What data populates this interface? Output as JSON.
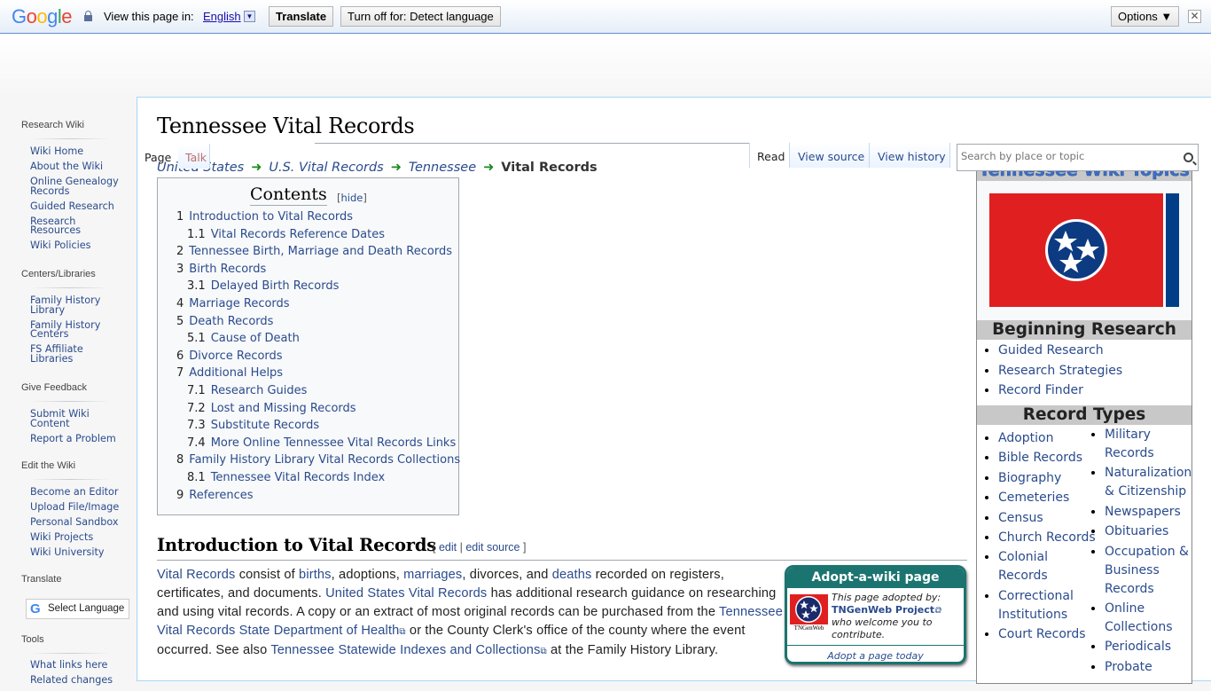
{
  "translate_bar": {
    "logo": [
      "G",
      "o",
      "o",
      "g",
      "l",
      "e"
    ],
    "view_label": "View this page in:",
    "language": "English",
    "language_dropdown": "▼",
    "translate_button": "Translate",
    "turn_off_button": "Turn off for: Detect language",
    "options_button": "Options ▼",
    "close": "✕"
  },
  "sidebar": {
    "sections": [
      {
        "heading": "Research Wiki",
        "items": [
          "Wiki Home",
          "About the Wiki",
          "Online Genealogy Records",
          "Guided Research",
          "Research Resources",
          "Wiki Policies"
        ]
      },
      {
        "heading": "Centers/Libraries",
        "items": [
          "Family History Library",
          "Family History Centers",
          "FS Affiliate Libraries"
        ]
      },
      {
        "heading": "Give Feedback",
        "items": [
          "Submit Wiki Content",
          "Report a Problem"
        ]
      },
      {
        "heading": "Edit the Wiki",
        "items": [
          "Become an Editor",
          "Upload File/Image",
          "Personal Sandbox",
          "Wiki Projects",
          "Wiki University"
        ]
      },
      {
        "heading": "Translate",
        "items": []
      },
      {
        "heading": "Tools",
        "items": [
          "What links here",
          "Related changes"
        ]
      }
    ],
    "select_language": "Select Language",
    "select_language_icon": "G"
  },
  "page": {
    "title": "Tennessee Vital Records",
    "tabs": {
      "page": "Page",
      "talk": "Talk",
      "read": "Read",
      "view_source": "View source",
      "view_history": "View history"
    },
    "search_placeholder": "Search by place or topic",
    "breadcrumb": [
      "United States",
      "U.S. Vital Records",
      "Tennessee",
      "Vital Records"
    ],
    "breadcrumb_arrow": "➜"
  },
  "toc": {
    "title": "Contents",
    "hide_label": "hide",
    "items": [
      {
        "num": "1",
        "label": "Introduction to Vital Records",
        "level": 1
      },
      {
        "num": "1.1",
        "label": "Vital Records Reference Dates",
        "level": 2
      },
      {
        "num": "2",
        "label": "Tennessee Birth, Marriage and Death Records",
        "level": 1
      },
      {
        "num": "3",
        "label": "Birth Records",
        "level": 1
      },
      {
        "num": "3.1",
        "label": "Delayed Birth Records",
        "level": 2
      },
      {
        "num": "4",
        "label": "Marriage Records",
        "level": 1
      },
      {
        "num": "5",
        "label": "Death Records",
        "level": 1
      },
      {
        "num": "5.1",
        "label": "Cause of Death",
        "level": 2
      },
      {
        "num": "6",
        "label": "Divorce Records",
        "level": 1
      },
      {
        "num": "7",
        "label": "Additional Helps",
        "level": 1
      },
      {
        "num": "7.1",
        "label": "Research Guides",
        "level": 2
      },
      {
        "num": "7.2",
        "label": "Lost and Missing Records",
        "level": 2
      },
      {
        "num": "7.3",
        "label": "Substitute Records",
        "level": 2
      },
      {
        "num": "7.4",
        "label": "More Online Tennessee Vital Records Links",
        "level": 2
      },
      {
        "num": "8",
        "label": "Family History Library Vital Records Collections",
        "level": 1
      },
      {
        "num": "8.1",
        "label": "Tennessee Vital Records Index",
        "level": 2
      },
      {
        "num": "9",
        "label": "References",
        "level": 1
      }
    ]
  },
  "section": {
    "heading": "Introduction to Vital Records",
    "edit": "edit",
    "edit_source": "edit source",
    "paragraph": [
      {
        "t": "Vital Records",
        "link": true
      },
      {
        "t": " consist of ",
        "link": false
      },
      {
        "t": "births",
        "link": true
      },
      {
        "t": ", adoptions, ",
        "link": false
      },
      {
        "t": "marriages",
        "link": true
      },
      {
        "t": ", divorces, and ",
        "link": false
      },
      {
        "t": "deaths",
        "link": true
      },
      {
        "t": " recorded on registers, certificates, and documents. ",
        "link": false
      },
      {
        "t": "United States Vital Records",
        "link": true
      },
      {
        "t": " has additional research guidance on researching and using vital records. A copy or an extract of most original records can be purchased from the ",
        "link": false
      },
      {
        "t": "Tennessee Vital Records State Department of Health",
        "link": true,
        "external": true
      },
      {
        "t": " or the County Clerk's office of the county where the event occurred. See also ",
        "link": false
      },
      {
        "t": "Tennessee Statewide Indexes and Collections",
        "link": true,
        "external": true
      },
      {
        "t": " at the Family History Library.",
        "link": false
      }
    ]
  },
  "adopt": {
    "header": "Adopt-a-wiki page",
    "line1": "This page adopted by:",
    "adopter": "TNGenWeb Project",
    "line2": "who welcome you to contribute.",
    "logo_caption": "TNGenWeb",
    "footer": "Adopt a page today"
  },
  "infobox": {
    "title": "Tennessee Wiki Topics",
    "flag_colors": {
      "red": "#e02020",
      "blue": "#003f87",
      "white": "#ffffff"
    },
    "beginning_heading": "Beginning Research",
    "beginning_items": [
      "Guided Research",
      "Research Strategies",
      "Record Finder"
    ],
    "record_types_heading": "Record Types",
    "record_types_col1": [
      "Adoption",
      "Bible Records",
      "Biography",
      "Cemeteries",
      "Census",
      "Church Records",
      "Colonial Records",
      "Correctional Institutions",
      "Court Records"
    ],
    "record_types_col2": [
      "Military Records",
      "Naturalization & Citizenship",
      "Newspapers",
      "Obituaries",
      "Occupation & Business Records",
      "Online Collections",
      "Periodicals",
      "Probate"
    ]
  }
}
